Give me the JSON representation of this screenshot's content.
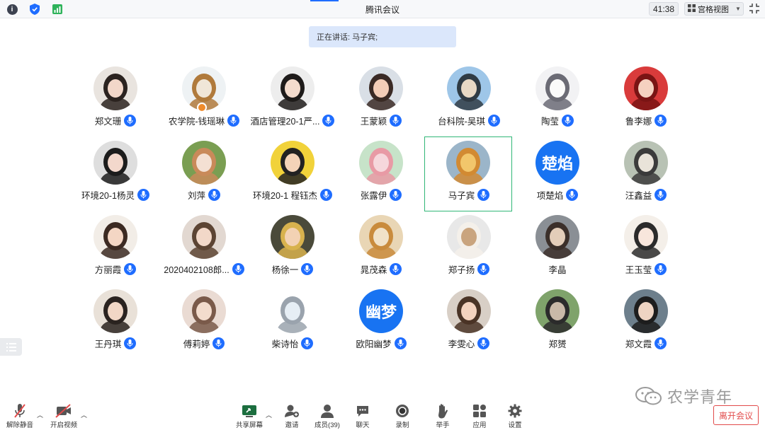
{
  "titlebar": {
    "title": "腾讯会议",
    "timer": "41:38",
    "view_mode": "宫格视图",
    "icons": [
      "info-icon",
      "shield-icon",
      "signal-icon",
      "fullscreen-icon"
    ]
  },
  "speaking": {
    "text": "正在讲话: 马子宾;"
  },
  "participants": [
    {
      "name": "郑文珊"
    },
    {
      "name": "农学院-钱瑶琳"
    },
    {
      "name": "酒店管理20-1严..."
    },
    {
      "name": "王蒙颖"
    },
    {
      "name": "台科院-吴琪"
    },
    {
      "name": "陶莹"
    },
    {
      "name": "鲁李娜"
    },
    {
      "name": "环境20-1杨灵"
    },
    {
      "name": "刘萍"
    },
    {
      "name": "环境20-1 程钰杰"
    },
    {
      "name": "张露伊"
    },
    {
      "name": "马子宾"
    },
    {
      "name": "项楚焰",
      "avatar_text": "楚焰"
    },
    {
      "name": "汪鑫益"
    },
    {
      "name": "方丽霞"
    },
    {
      "name": "2020402108郎..."
    },
    {
      "name": "杨徐一"
    },
    {
      "name": "晁茂森"
    },
    {
      "name": "郑子扬"
    },
    {
      "name": "李晶"
    },
    {
      "name": "王玉莹"
    },
    {
      "name": "王丹琪"
    },
    {
      "name": "傅莉婷"
    },
    {
      "name": "柴诗怡"
    },
    {
      "name": "欧阳幽梦",
      "avatar_text": "幽梦"
    },
    {
      "name": "李雯心"
    },
    {
      "name": "郑赟"
    },
    {
      "name": "郑文霞"
    }
  ],
  "toolbar": {
    "unmute": "解除静音",
    "start_video": "开启视频",
    "share_screen": "共享屏幕",
    "invite": "邀请",
    "members": "成员(39)",
    "chat": "聊天",
    "record": "录制",
    "raise_hand": "举手",
    "apps": "应用",
    "settings": "设置",
    "leave": "离开会议"
  },
  "watermark": {
    "text": "农学青年"
  },
  "colors": {
    "accent": "#1f6dff",
    "active_border": "#31b777",
    "leave": "#e24b4b"
  }
}
